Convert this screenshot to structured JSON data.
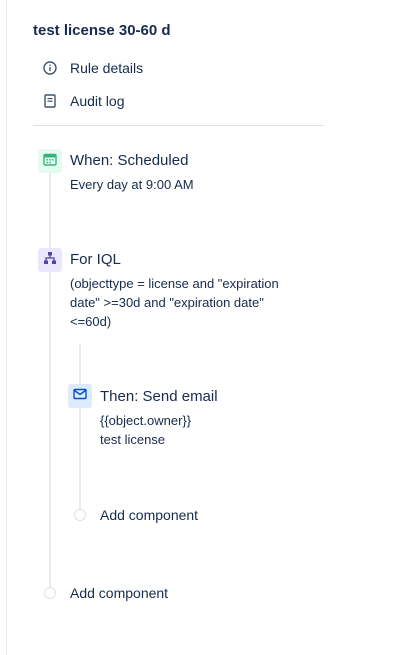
{
  "rule": {
    "title": "test license 30-60 d"
  },
  "menu": {
    "rule_details": "Rule details",
    "audit_log": "Audit log"
  },
  "trigger": {
    "title": "When: Scheduled",
    "description": "Every day at 9:00 AM",
    "icon": "calendar-icon",
    "color": "#e3fcef",
    "icon_color": "#36b37e"
  },
  "branch": {
    "title": "For IQL",
    "description": "(objecttype = license and \"expiration\ndate\" >=30d and \"expiration date\"\n<=60d)",
    "icon": "branch-icon",
    "color": "#eae6ff",
    "icon_color": "#5243aa"
  },
  "action": {
    "title": "Then: Send email",
    "description": "{{object.owner}}\ntest license",
    "icon": "email-icon",
    "color": "#deebff",
    "icon_color": "#0052cc"
  },
  "add_component_inner": "Add component",
  "add_component_outer": "Add component"
}
